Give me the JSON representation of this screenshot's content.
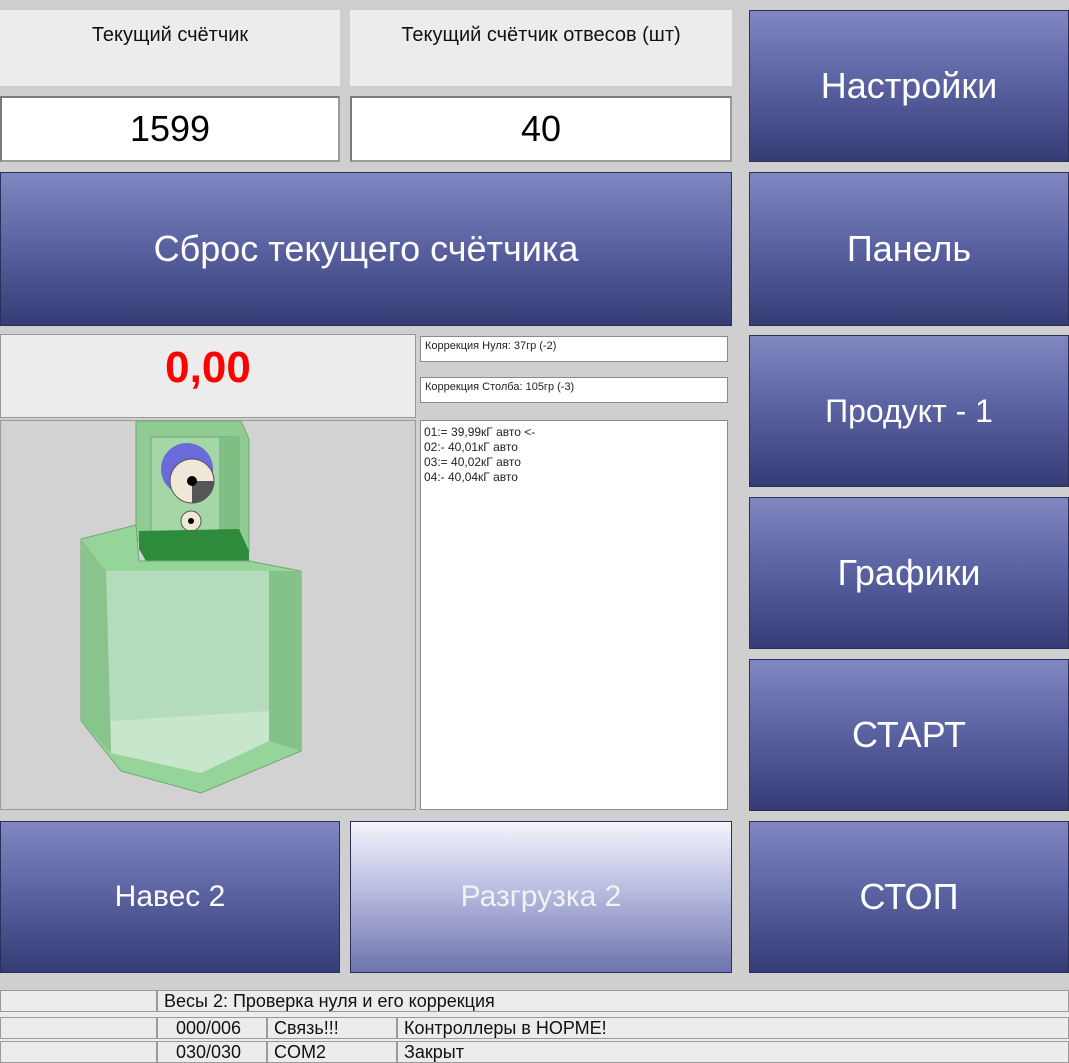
{
  "counters": {
    "current_label": "Текущий счётчик",
    "current_value": "1599",
    "weighings_label": "Текущий счётчик отвесов (шт)",
    "weighings_value": "40"
  },
  "buttons": {
    "reset": "Сброс текущего счётчика",
    "settings": "Настройки",
    "panel": "Панель",
    "product": "Продукт - 1",
    "graphs": "Графики",
    "start": "СТАРТ",
    "stop": "СТОП",
    "hang": "Навес 2",
    "unload": "Разгрузка 2"
  },
  "weight": {
    "display": "0,00",
    "color": "#ff0000"
  },
  "corrections": {
    "zero": "Коррекция Нуля: 37гр (-2)",
    "column": "Коррекция Столба: 105гр (-3)"
  },
  "log": [
    "01:= 39,99кГ авто <-",
    "02:- 40,01кГ авто",
    "03:= 40,02кГ авто",
    "04:- 40,04кГ авто"
  ],
  "status": {
    "message": "Весы 2: Проверка нуля и его коррекция",
    "row1": {
      "count": "000/006",
      "state": "Связь!!!",
      "info": "Контроллеры в НОРМЕ!"
    },
    "row2": {
      "count": "030/030",
      "state": "COM2",
      "info": "Закрыт"
    }
  },
  "colors": {
    "button_top": "#8087c0",
    "button_bottom": "#353c75",
    "machine_green": "#86c88c"
  }
}
